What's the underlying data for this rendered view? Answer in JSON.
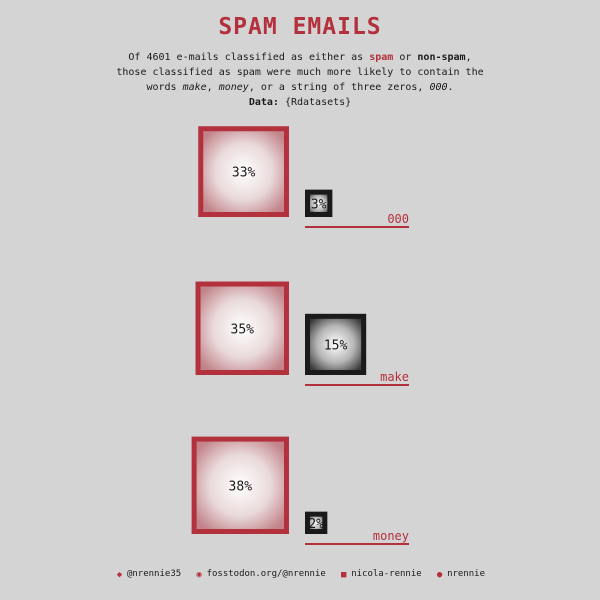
{
  "title": "SPAM EMAILS",
  "subtitle": {
    "line1_pre": "Of 4601 e-mails classified as either as ",
    "spam_word": "spam",
    "line1_mid": " or ",
    "nonspam_word": "non-spam",
    "line1_post": ",",
    "line2": "those classified as spam were much more likely to contain the",
    "line3_pre": "words ",
    "w1": "make",
    "sep1": ", ",
    "w2": "money",
    "sep2": ", or a string of three zeros, ",
    "w3": "000",
    "line3_post": ".",
    "data_label": "Data:",
    "data_source": " {Rdatasets}"
  },
  "colors": {
    "spam": "#b3313c",
    "nonspam": "#1a1a1a",
    "background": "#d4d4d4"
  },
  "chart_data": {
    "type": "square-area comparison",
    "categories": [
      "000",
      "make",
      "money"
    ],
    "series": [
      {
        "name": "spam",
        "values": [
          33,
          35,
          38
        ]
      },
      {
        "name": "non-spam",
        "values": [
          3,
          15,
          2
        ]
      }
    ],
    "value_labels": {
      "spam": [
        "33%",
        "35%",
        "38%"
      ],
      "non-spam": [
        "3%",
        "15%",
        "2%"
      ]
    }
  },
  "footer": {
    "twitter": "@nrennie35",
    "mastodon": "fosstodon.org/@nrennie",
    "linkedin": "nicola-rennie",
    "github": "nrennie",
    "icons": [
      "twitter-icon",
      "mastodon-icon",
      "linkedin-icon",
      "github-icon"
    ]
  }
}
